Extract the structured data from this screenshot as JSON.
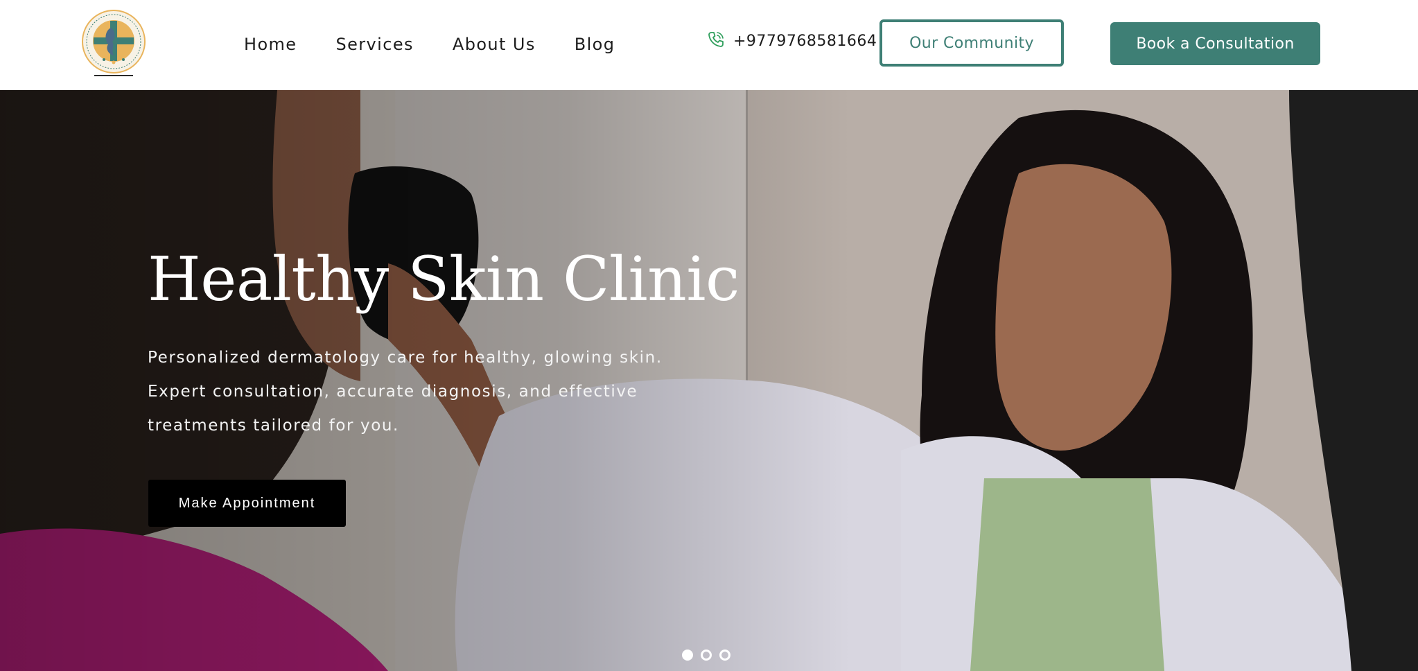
{
  "header": {
    "logo_icon": "clinic-logo-icon",
    "nav": [
      {
        "label": "Home"
      },
      {
        "label": "Services"
      },
      {
        "label": "About Us"
      },
      {
        "label": "Blog"
      }
    ],
    "phone": {
      "icon": "phone-icon",
      "number": "+9779768581664"
    },
    "community_button": "Our Community",
    "consult_button": "Book a Consultation"
  },
  "hero": {
    "title": "Healthy Skin Clinic",
    "description": "Personalized dermatology care for healthy, glowing skin. Expert consultation, accurate diagnosis, and effective treatments tailored for you.",
    "cta": "Make Appointment",
    "slider": {
      "total": 3,
      "active": 1
    }
  },
  "colors": {
    "brand_teal": "#3e7f75",
    "cta_black": "#000000",
    "logo_gold": "#e9b45c",
    "logo_teal": "#3e7f75"
  }
}
